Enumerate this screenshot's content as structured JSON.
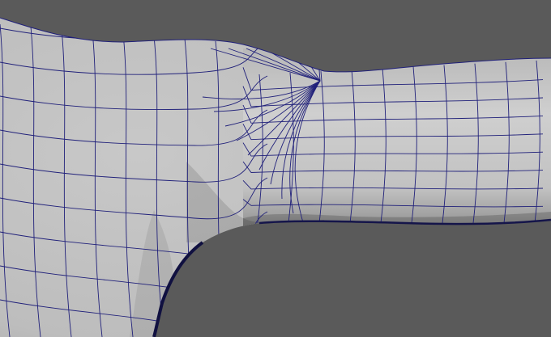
{
  "scene": {
    "description_visible_text": "",
    "background_color": "#5a5a5a",
    "surface_light": "#c9c9c9",
    "surface_mid": "#a9a9a9",
    "surface_dark": "#6e6e6e",
    "wire_color": "#20207a",
    "model": "polygon-mesh-torso-arm-junction"
  }
}
